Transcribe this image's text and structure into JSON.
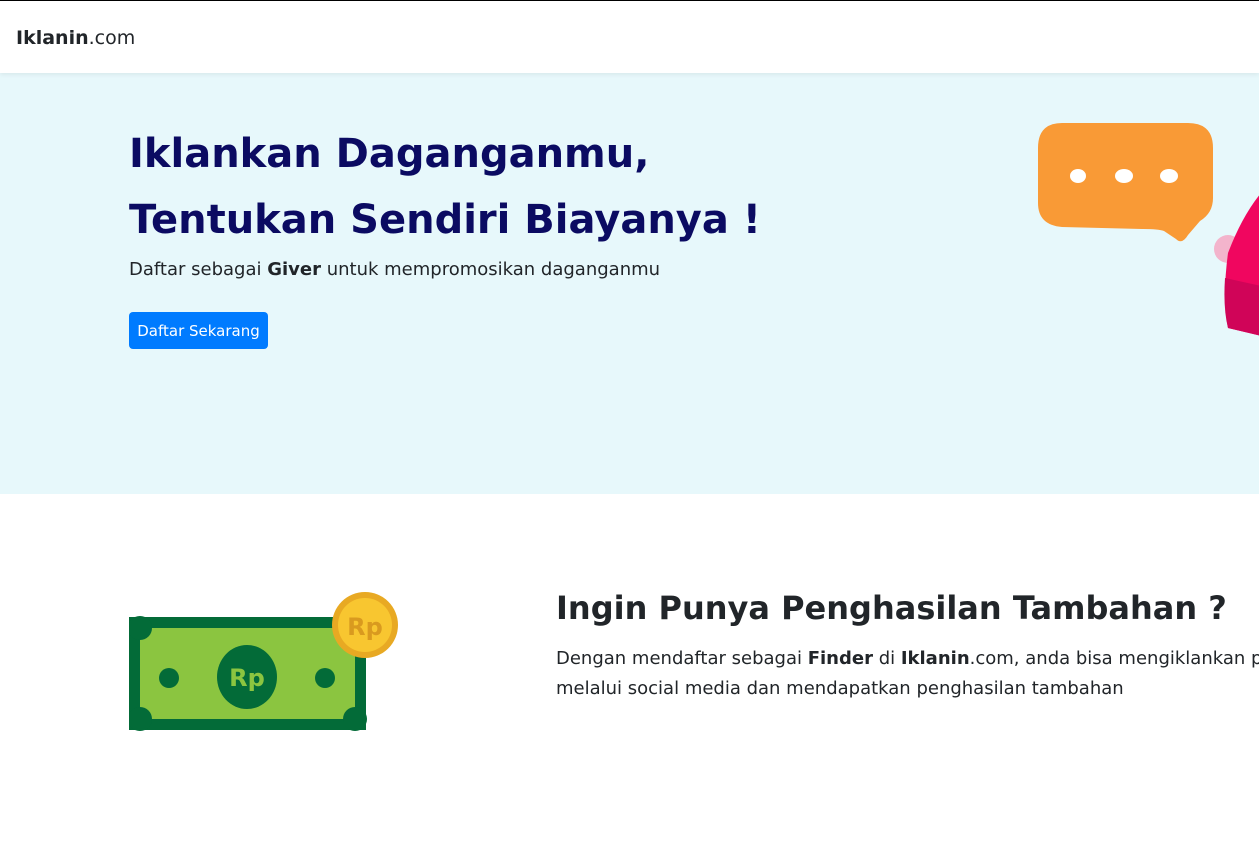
{
  "navbar": {
    "brand_bold": "Iklanin",
    "brand_rest": ".com"
  },
  "hero": {
    "title_line1": "Iklankan Daganganmu,",
    "title_line2": "Tentukan Sendiri Biayanya !",
    "subtitle_before": "Daftar sebagai ",
    "subtitle_bold": "Giver",
    "subtitle_after": " untuk mempromosikan daganganmu",
    "cta_label": "Daftar Sekarang",
    "illustration": "chat-bubble-icon"
  },
  "finder_section": {
    "title": "Ingin Punya Penghasilan Tambahan ?",
    "text_part1": "Dengan mendaftar sebagai ",
    "text_bold1": "Finder",
    "text_part2": " di ",
    "text_bold2": "Iklanin",
    "text_part3": ".com, anda bisa mengiklankan produk",
    "text_line2": "melalui social media dan mendapatkan penghasilan tambahan",
    "illustration": "money-icon",
    "note_label": "Rp",
    "coin_label": "Rp"
  },
  "colors": {
    "hero_background": "#e7f8fb",
    "title_navy": "#0b0b62",
    "button_blue": "#007bff",
    "bubble_orange": "#f99a36",
    "accent_pink": "#f0065f",
    "money_green": "#8bc540",
    "money_dark_green": "#036b38",
    "coin_gold": "#f8c630"
  }
}
